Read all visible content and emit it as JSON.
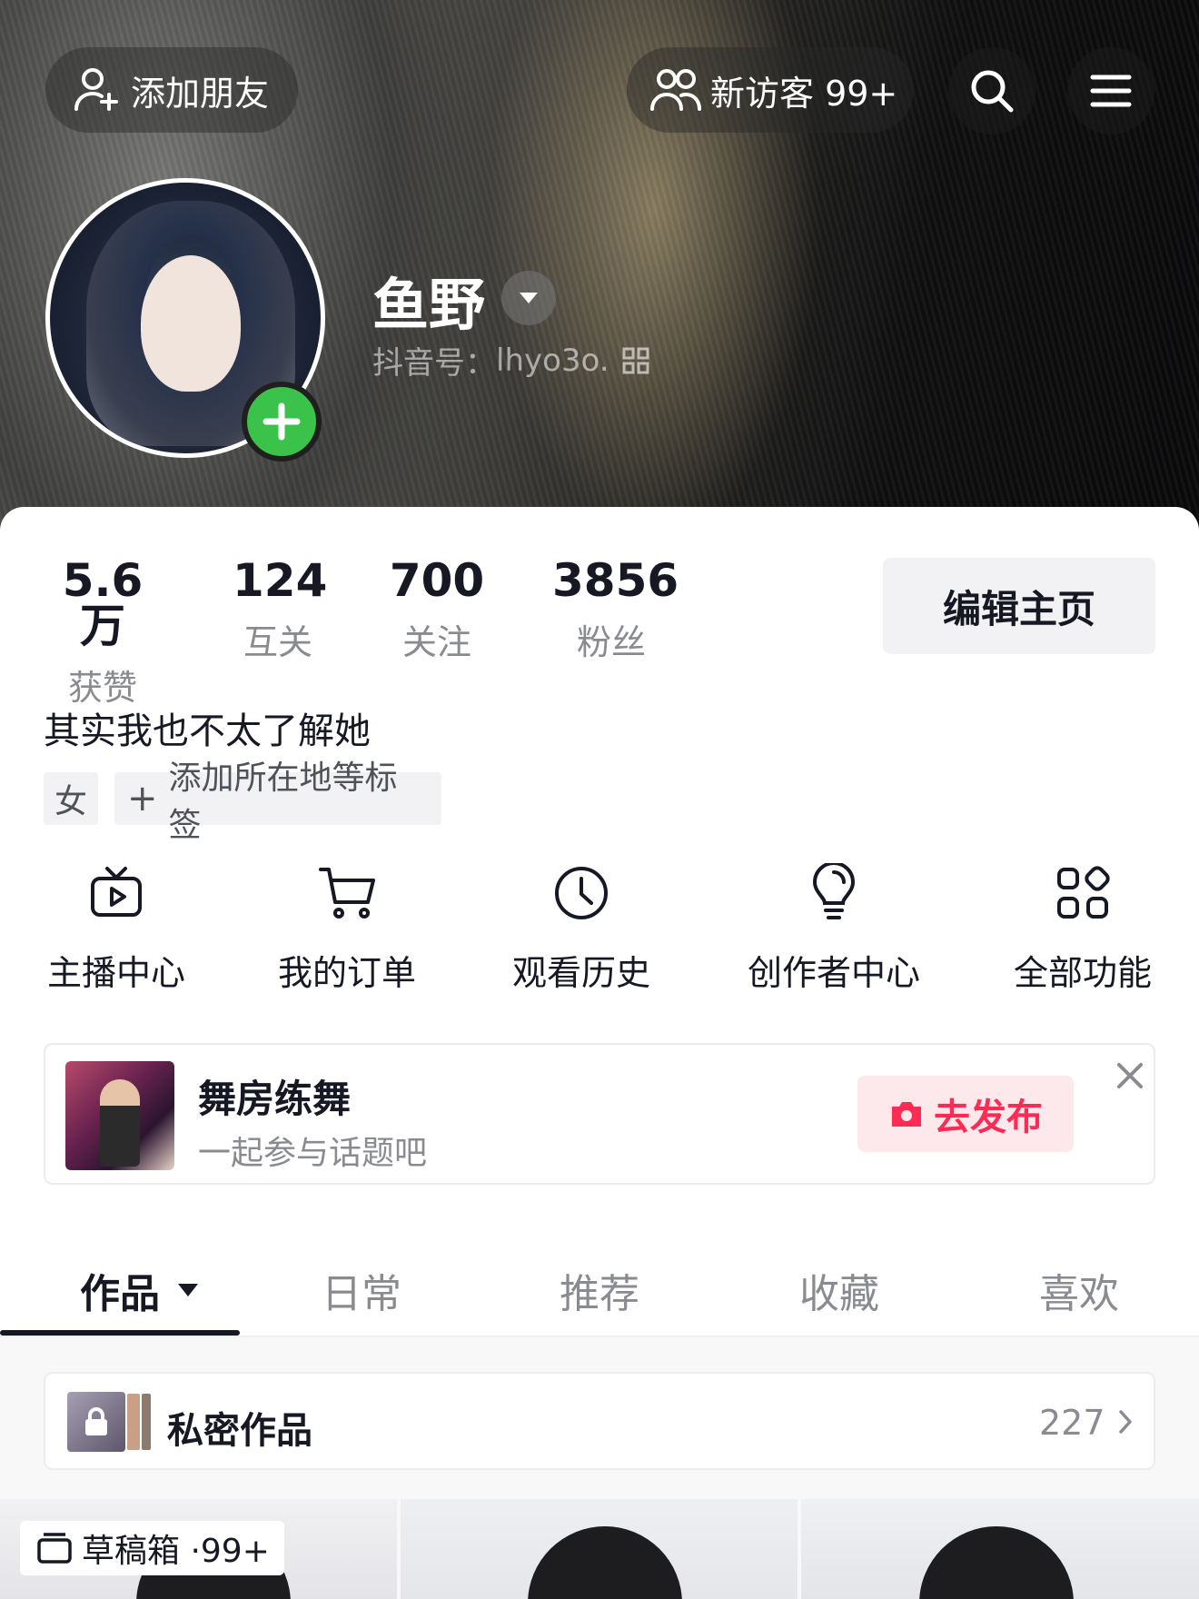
{
  "header": {
    "add_friend_label": "添加朋友",
    "visitors_label": "新访客 99+",
    "icons": [
      "add-user-icon",
      "visitors-icon",
      "search-icon",
      "menu-icon"
    ]
  },
  "profile": {
    "nickname": "鱼野",
    "douyin_id_label": "抖音号：",
    "douyin_id": "lhyo3o.",
    "stats": [
      {
        "value": "5.6万",
        "label": "获赞"
      },
      {
        "value": "124",
        "label": "互关"
      },
      {
        "value": "700",
        "label": "关注"
      },
      {
        "value": "3856",
        "label": "粉丝"
      }
    ],
    "edit_button": "编辑主页",
    "bio": "其实我也不太了解她",
    "tags": {
      "gender": "女",
      "add": "添加所在地等标签"
    }
  },
  "functions": [
    {
      "label": "主播中心",
      "icon": "tv-play-icon"
    },
    {
      "label": "我的订单",
      "icon": "cart-icon"
    },
    {
      "label": "观看历史",
      "icon": "clock-icon"
    },
    {
      "label": "创作者中心",
      "icon": "lightbulb-icon"
    },
    {
      "label": "全部功能",
      "icon": "grid-apps-icon"
    }
  ],
  "banner": {
    "title": "舞房练舞",
    "subtitle": "一起参与话题吧",
    "button": "去发布"
  },
  "tabs": [
    {
      "label": "作品",
      "active": true
    },
    {
      "label": "日常",
      "active": false
    },
    {
      "label": "推荐",
      "active": false
    },
    {
      "label": "收藏",
      "active": false
    },
    {
      "label": "喜欢",
      "active": false
    }
  ],
  "private_works": {
    "label": "私密作品",
    "count": "227"
  },
  "drafts": {
    "label": "草稿箱 ·99+"
  },
  "colors": {
    "accent": "#fe2c55",
    "plus_green": "#3bc24a",
    "text_primary": "#161823",
    "text_secondary": "#8a8b91"
  }
}
